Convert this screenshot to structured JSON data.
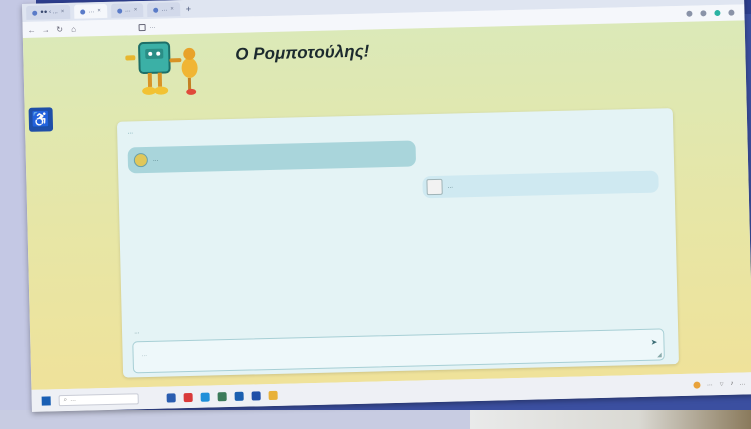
{
  "browser": {
    "tabs": [
      {
        "label": "●● ‹ ..."
      },
      {
        "label": "…",
        "active": true
      },
      {
        "label": "…"
      },
      {
        "label": "…"
      }
    ],
    "new_tab": "+",
    "url": "…",
    "window_controls": [
      "—",
      "□",
      "✕"
    ]
  },
  "site": {
    "title": "Ο Ρομποτούλης!",
    "side_button_icon": "accessibility-icon"
  },
  "chat": {
    "header": "…",
    "bot_message": "…",
    "user_message": "…",
    "input_label": "…",
    "input_placeholder": "…",
    "send_icon": "send-icon"
  },
  "taskbar": {
    "search_placeholder": "…",
    "tray_time": "…",
    "weather": "…"
  },
  "colors": {
    "frame": "#3b4fa0",
    "page_top": "#dbe9b8",
    "page_bottom": "#efe29a",
    "chat_card": "#e4f3f5",
    "bot_bubble": "#a9d5db",
    "user_bubble": "#cfe9f1",
    "accent": "#1f4fa8"
  }
}
